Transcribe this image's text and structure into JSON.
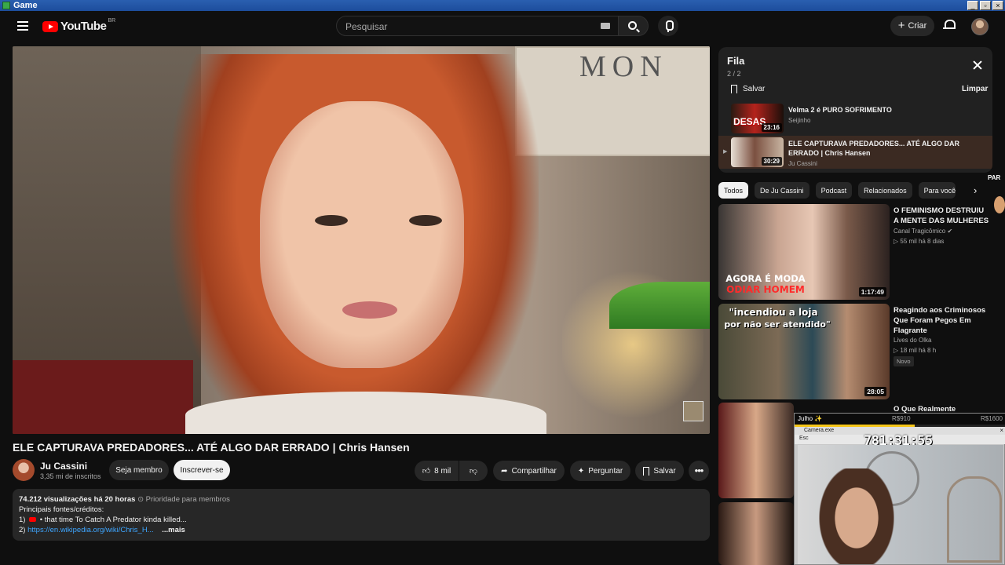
{
  "window": {
    "title": "Game",
    "controls": [
      "_",
      "▫",
      "×"
    ]
  },
  "masthead": {
    "logo_text": "YouTube",
    "country_code": "BR",
    "search_placeholder": "Pesquisar",
    "create_label": "Criar"
  },
  "video": {
    "title": "ELE CAPTURAVA PREDADORES... ATÉ ALGO DAR ERRADO | Chris Hansen",
    "channel": "Ju Cassini",
    "subscribers": "3,35 mi de inscritos",
    "member_button": "Seja membro",
    "subscribe_button": "Inscrever-se",
    "likes": "8 mil",
    "share": "Compartilhar",
    "ask": "Perguntar",
    "save": "Salvar"
  },
  "description": {
    "views": "74.212 visualizações",
    "time": "há 20 horas",
    "priority": "Prioridade para membros",
    "sources_label": "Principais fontes/créditos:",
    "line1_num": "1)",
    "line1_text": "• that time To Catch A Predator kinda killed...",
    "line2_num": "2)",
    "line2_link": "https://en.wikipedia.org/wiki/Chris_H...",
    "more": "...mais"
  },
  "queue": {
    "title": "Fila",
    "count": "2 / 2",
    "save": "Salvar",
    "clear": "Limpar",
    "items": [
      {
        "title": "Velma 2 é PURO SOFRIMENTO",
        "channel": "Seijinho",
        "duration": "23:16",
        "thumb_text": "DESAS"
      },
      {
        "title": "ELE CAPTURAVA PREDADORES... ATÉ ALGO DAR ERRADO | Chris Hansen",
        "channel": "Ju Cassini",
        "duration": "30:29"
      }
    ]
  },
  "chips": [
    "Todos",
    "De Ju Cassini",
    "Podcast",
    "Relacionados",
    "Para você"
  ],
  "recommendations": [
    {
      "title": "O FEMINISMO DESTRUIU A MENTE DAS MULHERES",
      "channel": "Canal Tragicômico",
      "meta": "▷ 55 mil  há 8 dias",
      "duration": "1:17:49",
      "thumb_line1": "AGORA É MODA",
      "thumb_line2": "ODIAR HOMEM"
    },
    {
      "title": "Reagindo aos Criminosos Que Foram Pegos Em Flagrante",
      "channel": "Lives do Olka",
      "meta": "▷ 18 mil  há 8 h",
      "badge": "Novo",
      "duration": "28:05",
      "thumb_line1": "\"incendiou a loja",
      "thumb_line2": "por não ser atendido\""
    },
    {
      "title": "O Que Realmente Aconteceu",
      "channel": "",
      "meta": "",
      "duration": ""
    }
  ],
  "overlay": {
    "left_label": "Julho ✨",
    "mid_label": "R$910",
    "right_label": "R$1600",
    "progress": 0.57,
    "source_label": "Camera.exe",
    "esc_label": "Esc",
    "timer": "781:31:55"
  },
  "edge_text": "PAR"
}
